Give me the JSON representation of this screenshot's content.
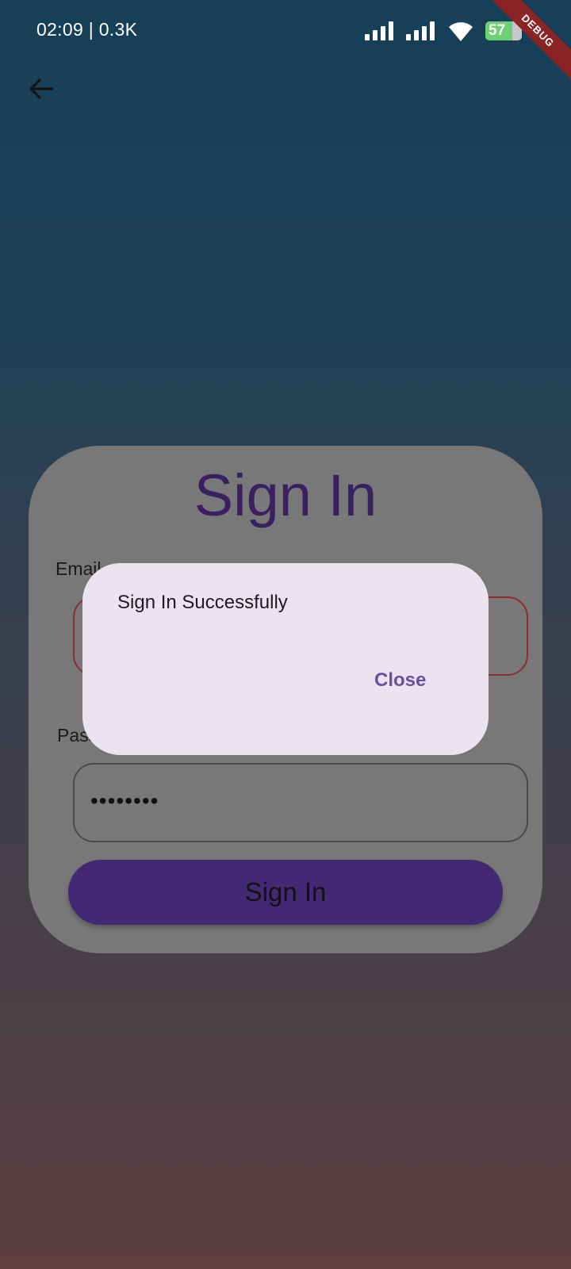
{
  "status_bar": {
    "time": "02:09 | 0.3K",
    "battery": "57"
  },
  "debug_banner": "DEBUG",
  "card": {
    "title": "Sign In",
    "email_label": "Email",
    "password_label": "Password",
    "password_value": "••••••••",
    "signin_button": "Sign In"
  },
  "dialog": {
    "message": "Sign In Successfully",
    "close_label": "Close"
  },
  "icons": {
    "back": "arrow-back-icon",
    "signal": "cellular-signal-icon",
    "wifi": "wifi-icon",
    "battery": "battery-icon"
  },
  "colors": {
    "dialog_background": "#ebe4f0",
    "accent": "#6a4fa0",
    "button": "#452874",
    "error_border": "#8b2e2e"
  }
}
